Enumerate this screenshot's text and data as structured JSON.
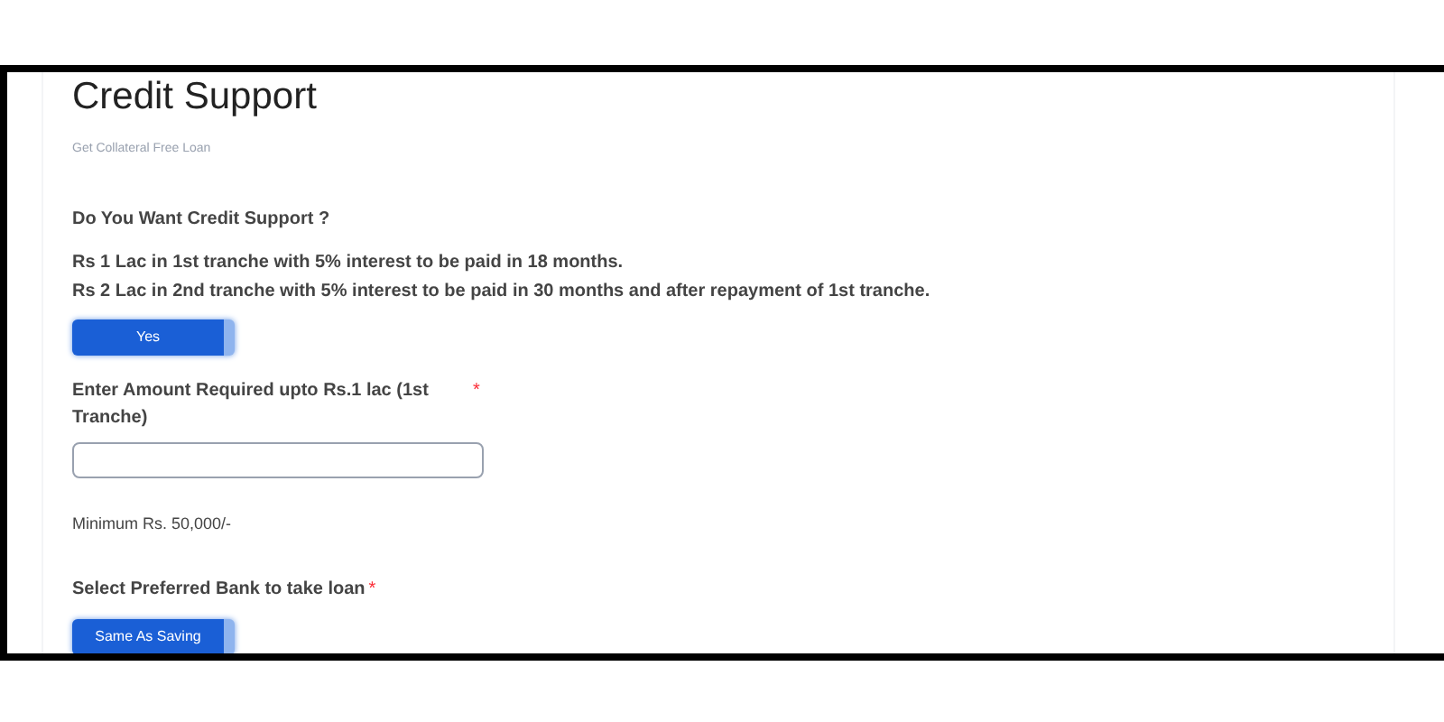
{
  "title": "Credit Support",
  "subtitle": "Get Collateral Free Loan",
  "question": "Do You Want Credit Support ?",
  "terms": [
    "Rs 1 Lac in 1st tranche with 5% interest to be paid in 18 months.",
    "Rs 2 Lac in 2nd tranche with 5% interest to be paid in 30 months and after repayment of 1st tranche."
  ],
  "credit_toggle": {
    "label": "Yes",
    "selected": true
  },
  "amount_field": {
    "label": "Enter Amount Required upto Rs.1 lac (1st Tranche)",
    "required_mark": "*",
    "hint": "Minimum Rs. 50,000/-"
  },
  "bank": {
    "label": "Select Preferred Bank to take loan",
    "required_mark": "*",
    "toggle": {
      "label": "Same As Saving",
      "selected": true
    }
  }
}
